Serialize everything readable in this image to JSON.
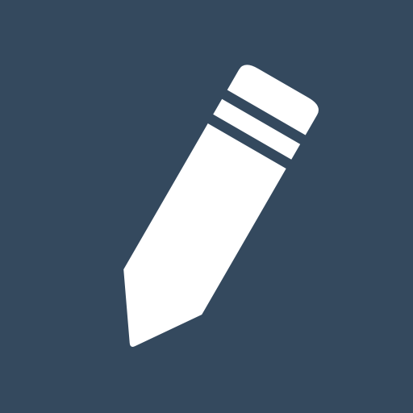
{
  "icon": {
    "name": "pencil-icon",
    "background_color": "#34495e",
    "foreground_color": "#ffffff"
  }
}
